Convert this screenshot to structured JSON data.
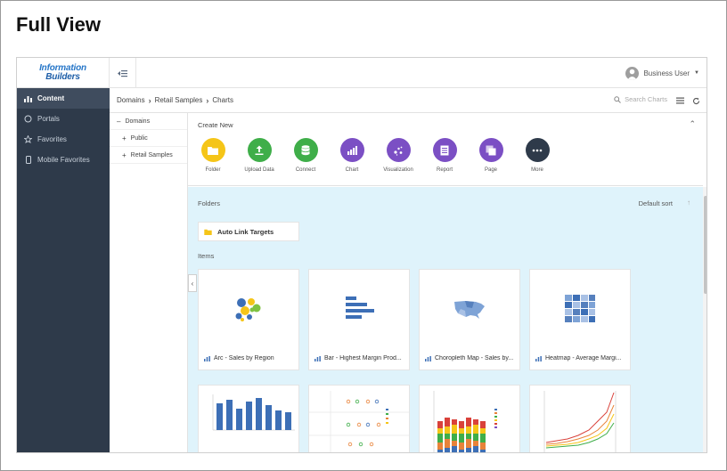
{
  "page_heading": "Full View",
  "brand": {
    "line1": "Information",
    "line2": "Builders"
  },
  "user": {
    "name": "Business User"
  },
  "sidebar": {
    "items": [
      {
        "label": "Content",
        "icon": "bar-chart-icon",
        "active": true
      },
      {
        "label": "Portals",
        "icon": "circle-icon",
        "active": false
      },
      {
        "label": "Favorites",
        "icon": "star-icon",
        "active": false
      },
      {
        "label": "Mobile Favorites",
        "icon": "phone-icon",
        "active": false
      }
    ]
  },
  "breadcrumb": {
    "items": [
      "Domains",
      "Retail Samples",
      "Charts"
    ]
  },
  "search": {
    "placeholder": "Search Charts"
  },
  "tree": {
    "root": "Domains",
    "children": [
      "Public",
      "Retail Samples"
    ]
  },
  "create_new": {
    "title": "Create New",
    "items": [
      {
        "label": "Folder",
        "color": "#f5c518",
        "icon": "folder-icon"
      },
      {
        "label": "Upload Data",
        "color": "#3fae49",
        "icon": "upload-icon"
      },
      {
        "label": "Connect",
        "color": "#3fae49",
        "icon": "database-icon"
      },
      {
        "label": "Chart",
        "color": "#7b4fc4",
        "icon": "chart-icon"
      },
      {
        "label": "Visualization",
        "color": "#7b4fc4",
        "icon": "visualization-icon"
      },
      {
        "label": "Report",
        "color": "#7b4fc4",
        "icon": "report-icon"
      },
      {
        "label": "Page",
        "color": "#7b4fc4",
        "icon": "page-icon"
      },
      {
        "label": "More",
        "color": "#2e3a4a",
        "icon": "more-icon"
      }
    ]
  },
  "folders": {
    "label": "Folders",
    "sort": "Default sort",
    "items": [
      "Auto Link Targets"
    ]
  },
  "items": {
    "label": "Items",
    "cards": [
      "Arc - Sales by Region",
      "Bar - Highest Margin Prod...",
      "Choropleth Map - Sales by...",
      "Heatmap - Average Margi..."
    ]
  },
  "colors": {
    "sidebar_bg": "#2e3a4a",
    "content_bg": "#dff3fb",
    "accent_blue": "#3d6fb6"
  }
}
